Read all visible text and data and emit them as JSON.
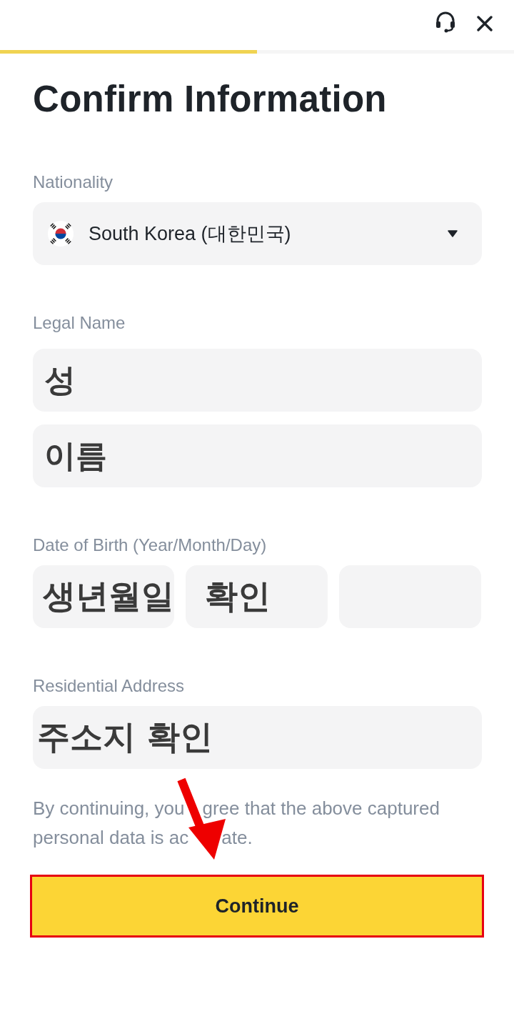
{
  "header": {
    "progress": {
      "level": 0.5
    }
  },
  "title": "Confirm Information",
  "nationality": {
    "label": "Nationality",
    "value": "South Korea (대한민국)"
  },
  "legal_name": {
    "label": "Legal Name",
    "fields": [
      {
        "value": "성"
      },
      {
        "value": "이름"
      }
    ]
  },
  "date_of_birth": {
    "label": "Date of Birth (Year/Month/Day)",
    "fields": [
      {
        "kind": "year",
        "value": "생년월일"
      },
      {
        "kind": "month",
        "value": "확인"
      },
      {
        "kind": "day"
      }
    ]
  },
  "residential_address": {
    "label": "Residential Address",
    "value": "주소지 확인"
  },
  "consent_text": [
    {
      "before": "By continuing, you",
      "after": "gree that the above captured"
    },
    {
      "before": "personal data is ac",
      "after": "ate."
    }
  ],
  "continue_button": {
    "label": "Continue"
  }
}
